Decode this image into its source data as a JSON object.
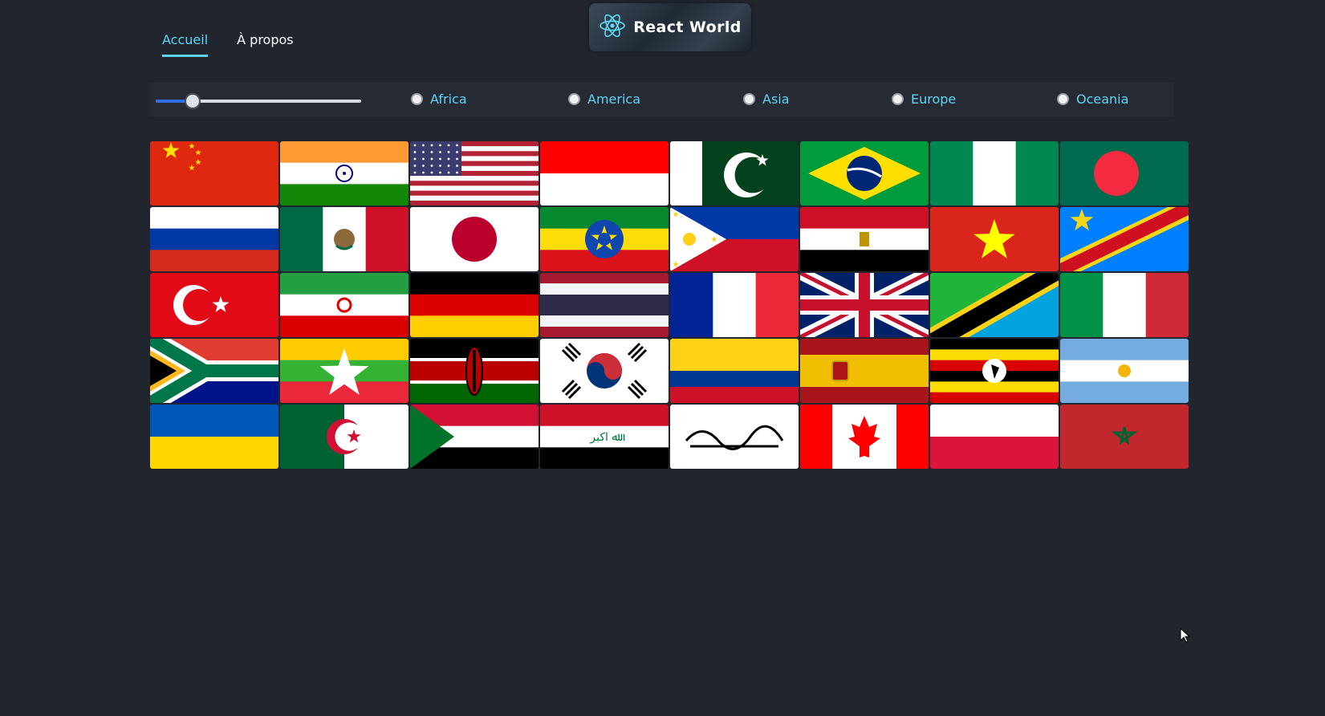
{
  "nav": {
    "items": [
      {
        "label": "Accueil",
        "active": true
      },
      {
        "label": "À propos",
        "active": false
      }
    ]
  },
  "logo": {
    "text": "React World",
    "icon": "react-icon"
  },
  "filters": {
    "range_value": 0.18,
    "regions": [
      "Africa",
      "America",
      "Asia",
      "Europe",
      "Oceania"
    ]
  },
  "colors": {
    "accent": "#60d4f8",
    "background": "#21252d"
  },
  "flags": [
    "china",
    "india",
    "usa",
    "indonesia",
    "pakistan",
    "brazil",
    "nigeria",
    "bangladesh",
    "russia",
    "mexico",
    "japan",
    "ethiopia",
    "philippines",
    "egypt",
    "vietnam",
    "dr-congo",
    "turkey",
    "iran",
    "germany",
    "thailand",
    "france",
    "united-kingdom",
    "tanzania",
    "italy",
    "south-africa",
    "myanmar",
    "kenya",
    "south-korea",
    "colombia",
    "spain",
    "uganda",
    "argentina",
    "ukraine",
    "algeria",
    "sudan",
    "iraq",
    "afghanistan",
    "canada",
    "poland",
    "morocco"
  ]
}
